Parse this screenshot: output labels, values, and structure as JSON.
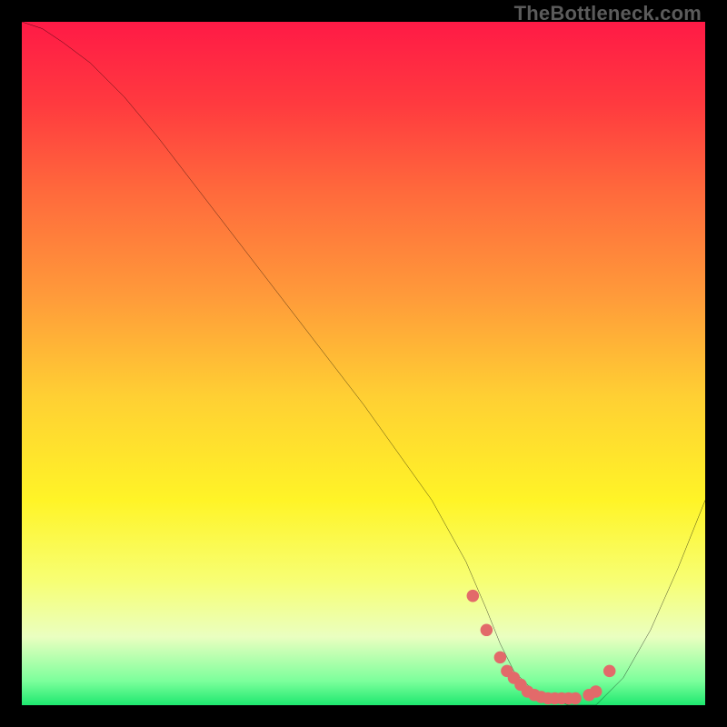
{
  "watermark": "TheBottleneck.com",
  "chart_data": {
    "type": "line",
    "title": "",
    "xlabel": "",
    "ylabel": "",
    "xlim": [
      0,
      100
    ],
    "ylim": [
      0,
      100
    ],
    "grid": false,
    "legend": false,
    "background_gradient": {
      "stops": [
        {
          "pos": 0.0,
          "color": "#ff1a46"
        },
        {
          "pos": 0.12,
          "color": "#ff3a3f"
        },
        {
          "pos": 0.25,
          "color": "#ff6a3c"
        },
        {
          "pos": 0.4,
          "color": "#ff9a3a"
        },
        {
          "pos": 0.55,
          "color": "#ffd033"
        },
        {
          "pos": 0.7,
          "color": "#fff427"
        },
        {
          "pos": 0.82,
          "color": "#f7ff75"
        },
        {
          "pos": 0.9,
          "color": "#eaffc0"
        },
        {
          "pos": 0.965,
          "color": "#7bff9b"
        },
        {
          "pos": 1.0,
          "color": "#1ee86f"
        }
      ]
    },
    "series": [
      {
        "name": "bottleneck-curve",
        "color": "#000000",
        "width": 2,
        "x": [
          0,
          3,
          6,
          10,
          15,
          20,
          30,
          40,
          50,
          60,
          65,
          68,
          70,
          72,
          75,
          80,
          84,
          88,
          92,
          96,
          100
        ],
        "y": [
          100,
          99,
          97,
          94,
          89,
          83,
          70,
          57,
          44,
          30,
          21,
          14,
          9,
          5,
          2,
          0,
          0,
          4,
          11,
          20,
          30
        ]
      },
      {
        "name": "optimal-zone-dots",
        "type": "scatter",
        "color": "#e26a6a",
        "marker_size": 6,
        "x": [
          66,
          68,
          70,
          71,
          72,
          73,
          74,
          75,
          76,
          77,
          78,
          79,
          80,
          81,
          83,
          84,
          86
        ],
        "y": [
          16,
          11,
          7,
          5,
          4,
          3,
          2,
          1.5,
          1.2,
          1.0,
          1.0,
          1.0,
          1.0,
          1.0,
          1.5,
          2,
          5
        ]
      }
    ]
  }
}
